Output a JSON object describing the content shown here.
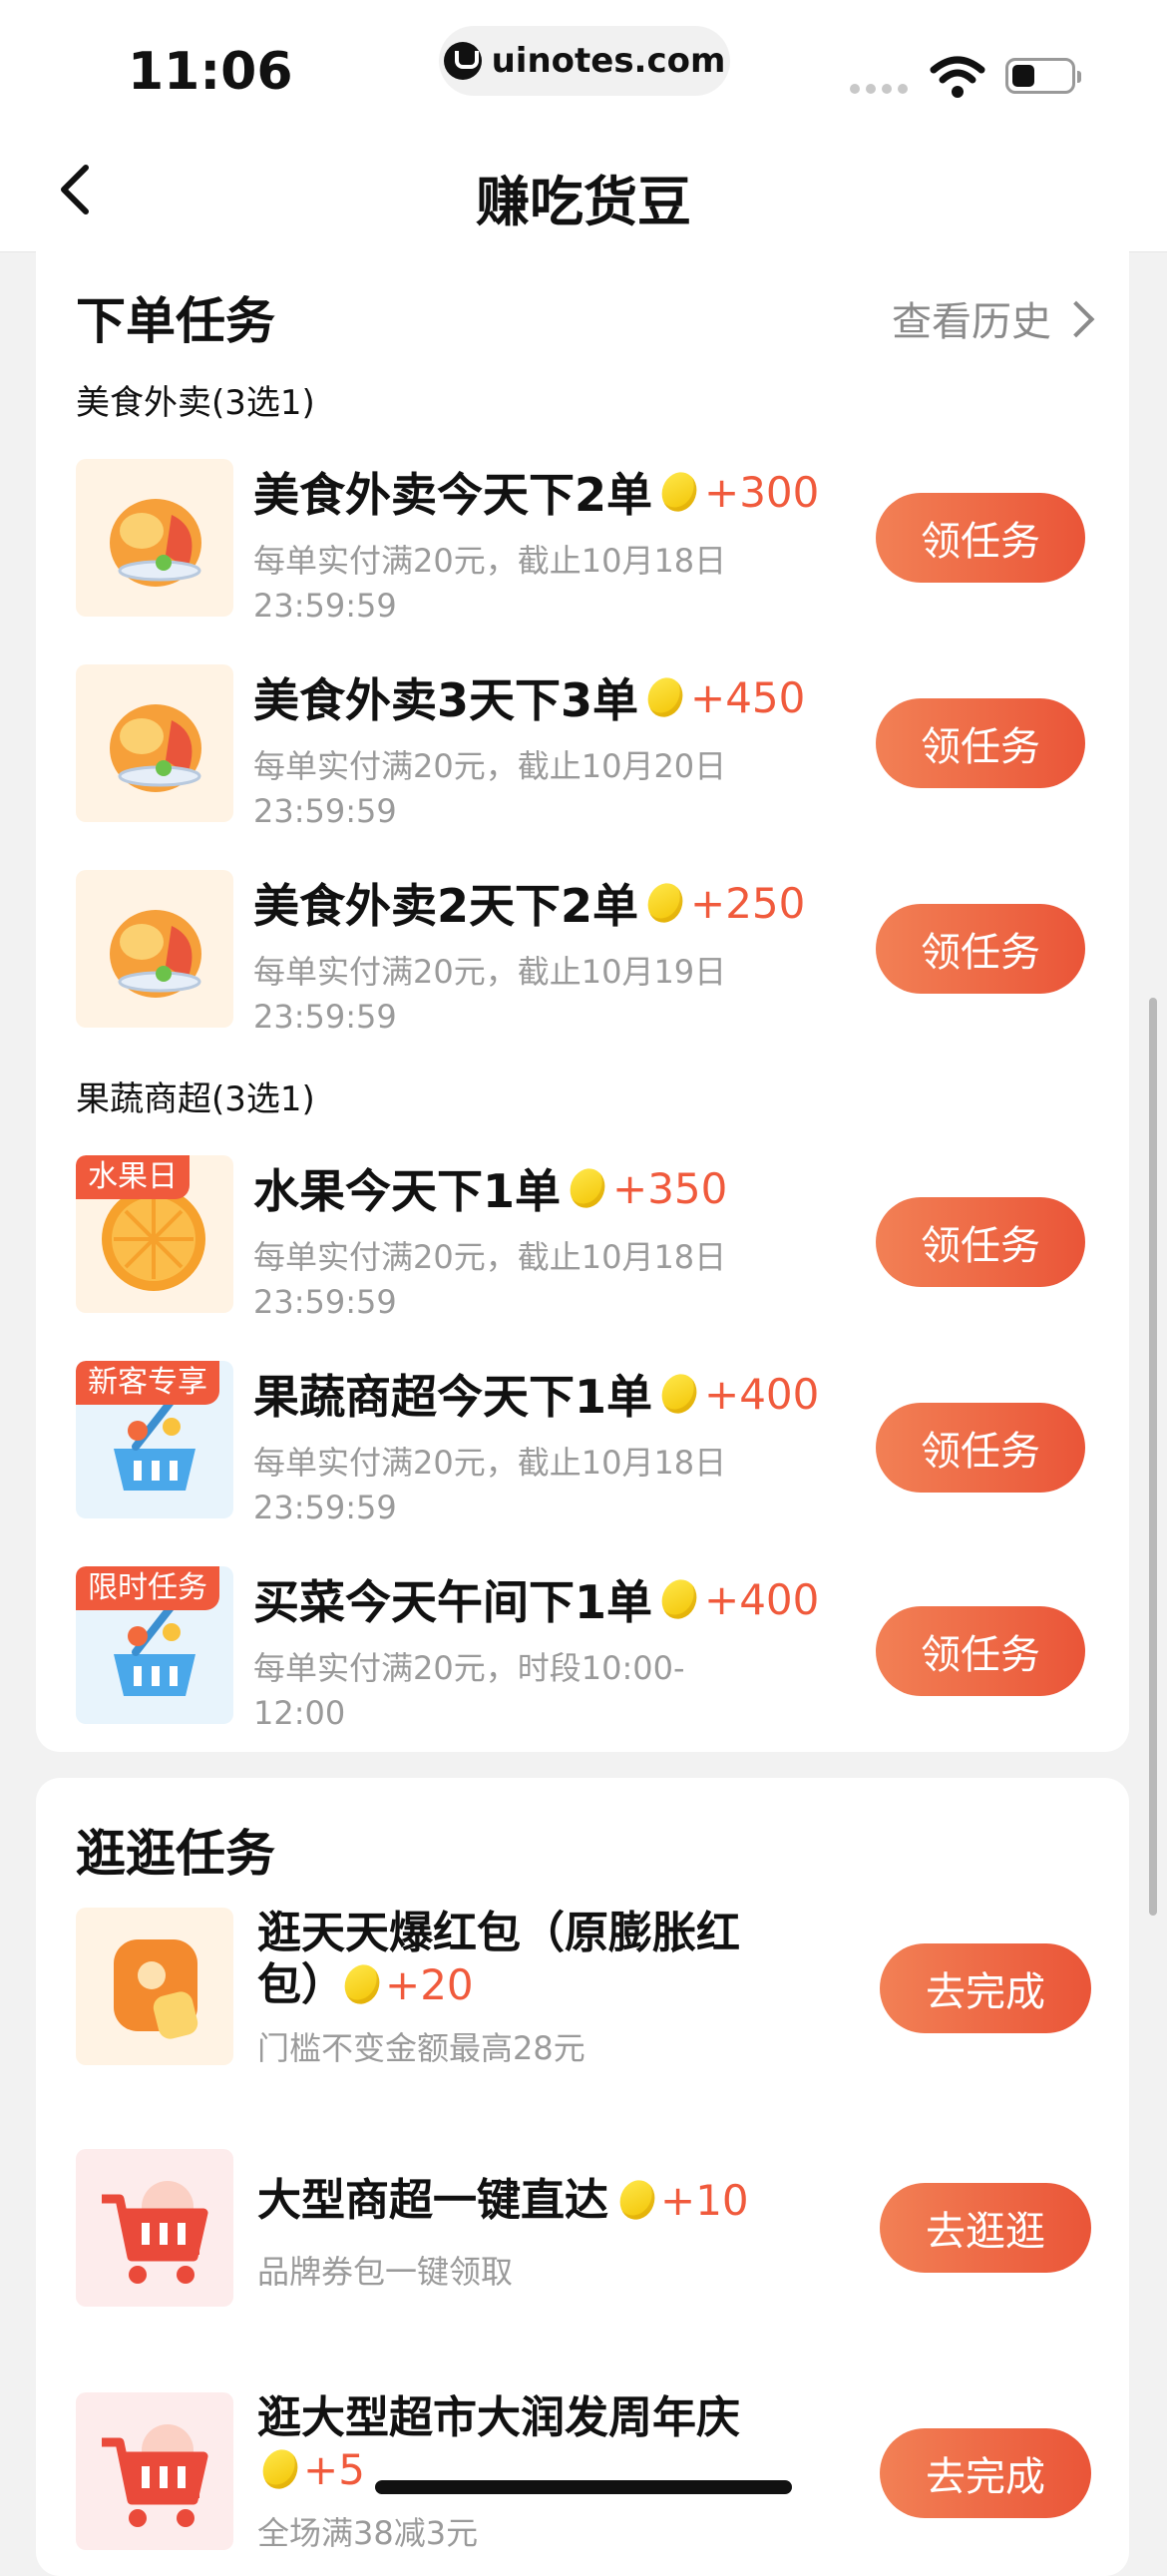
{
  "status_bar": {
    "time": "11:06",
    "url": "uinotes.com"
  },
  "nav": {
    "title": "赚吃货豆"
  },
  "order_section": {
    "title": "下单任务",
    "history_label": "查看历史",
    "groups": [
      {
        "label": "美食外卖(3选1)",
        "tasks": [
          {
            "title": "美食外卖今天下2单",
            "reward": "+300",
            "desc_line1": "每单实付满20元，截止10月18日",
            "desc_line2": "23:59:59",
            "button": "领任务",
            "icon": "food-icon"
          },
          {
            "title": "美食外卖3天下3单",
            "reward": "+450",
            "desc_line1": "每单实付满20元，截止10月20日",
            "desc_line2": "23:59:59",
            "button": "领任务",
            "icon": "food-icon"
          },
          {
            "title": "美食外卖2天下2单",
            "reward": "+250",
            "desc_line1": "每单实付满20元，截止10月19日",
            "desc_line2": "23:59:59",
            "button": "领任务",
            "icon": "food-icon"
          }
        ]
      },
      {
        "label": "果蔬商超(3选1)",
        "tasks": [
          {
            "tag": "水果日",
            "title": "水果今天下1单",
            "reward": "+350",
            "desc_line1": "每单实付满20元，截止10月18日",
            "desc_line2": "23:59:59",
            "button": "领任务",
            "icon": "orange-icon"
          },
          {
            "tag": "新客专享",
            "title": "果蔬商超今天下1单",
            "reward": "+400",
            "desc_line1": "每单实付满20元，截止10月18日",
            "desc_line2": "23:59:59",
            "button": "领任务",
            "icon": "basket-icon"
          },
          {
            "tag": "限时任务",
            "title": "买菜今天午间下1单",
            "reward": "+400",
            "desc_line1": "每单实付满20元，时段10:00-12:00",
            "button": "领任务",
            "icon": "basket-icon"
          }
        ]
      }
    ]
  },
  "browse_section": {
    "title": "逛逛任务",
    "tasks": [
      {
        "title_line1": "逛天天爆红包（原膨胀红",
        "title_line2": "包）",
        "reward": "+20",
        "desc": "门槛不变金额最高28元",
        "button": "去完成",
        "icon": "red-packet-icon"
      },
      {
        "title_line1": "大型商超一键直达",
        "reward": "+10",
        "desc": "品牌券包一键领取",
        "button": "去逛逛",
        "icon": "shopping-cart-icon"
      },
      {
        "title_line1": "逛大型超市大润发周年庆",
        "reward": "+5",
        "desc": "全场满38减3元",
        "button": "去完成",
        "icon": "shopping-cart-icon"
      }
    ]
  },
  "colors": {
    "accent": "#f05a3c",
    "coin": "#f5cc00",
    "page_bg": "#f2f2f2"
  }
}
